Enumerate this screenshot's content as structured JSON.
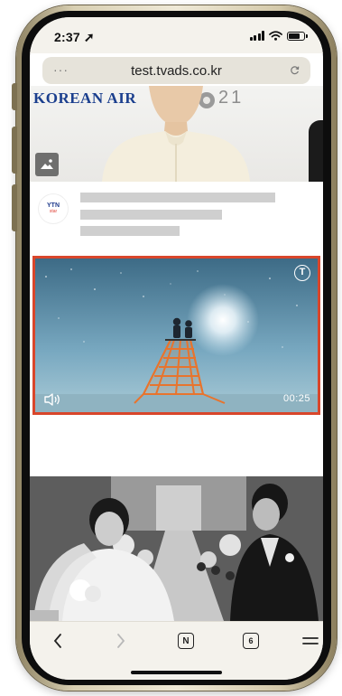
{
  "status_bar": {
    "time": "2:37",
    "signal_bars": 4,
    "battery_level": 0.8
  },
  "browser": {
    "url": "test.tvads.co.kr",
    "more_label": "···"
  },
  "hero": {
    "airline_logo": "KOREAN AIR",
    "event_number": "21",
    "badge_icon": "image-icon"
  },
  "news": {
    "publisher_logo": "YTN",
    "publisher_logo_sub": "star"
  },
  "video_ad": {
    "badge_letter": "T",
    "duration": "00:25",
    "sound_icon": "speaker-icon"
  },
  "toolbar": {
    "back_icon": "chevron-left-icon",
    "forward_icon": "chevron-right-icon",
    "naver_label": "N",
    "tabs_count": "6",
    "menu_icon": "hamburger-icon"
  },
  "colors": {
    "ad_border": "#d9462b",
    "status_bg": "#f4f2ec",
    "url_bg": "#e6e3da",
    "placeholder": "#cfcfcf"
  }
}
